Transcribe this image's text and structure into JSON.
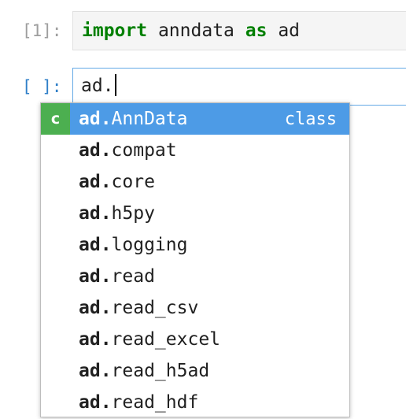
{
  "cells": [
    {
      "prompt": "[1]:",
      "code": {
        "keyword1": "import",
        "name": "anndata",
        "keyword2": "as",
        "alias": "ad"
      },
      "state": "executed"
    },
    {
      "prompt": "[ ]:",
      "code_text": "ad.",
      "state": "editing"
    }
  ],
  "completer": {
    "prefix": "ad.",
    "items": [
      {
        "match": "ad.",
        "rest": "AnnData",
        "type_badge": "c",
        "type": "class",
        "selected": true
      },
      {
        "match": "ad.",
        "rest": "compat"
      },
      {
        "match": "ad.",
        "rest": "core"
      },
      {
        "match": "ad.",
        "rest": "h5py"
      },
      {
        "match": "ad.",
        "rest": "logging"
      },
      {
        "match": "ad.",
        "rest": "read"
      },
      {
        "match": "ad.",
        "rest": "read_csv"
      },
      {
        "match": "ad.",
        "rest": "read_excel"
      },
      {
        "match": "ad.",
        "rest": "read_h5ad"
      },
      {
        "match": "ad.",
        "rest": "read_hdf"
      }
    ]
  },
  "colors": {
    "keyword": "#008000",
    "selected_bg": "#4d9be6",
    "badge_class": "#4caf50",
    "active_prompt": "#2f7fc8",
    "active_border": "#64a9e6"
  }
}
